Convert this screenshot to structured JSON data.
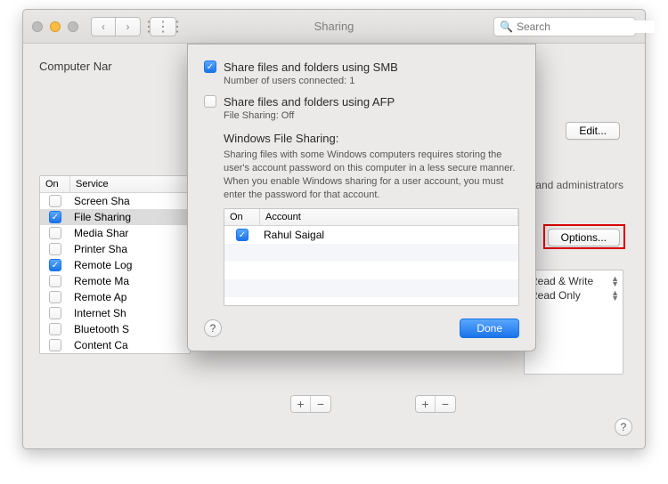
{
  "titlebar": {
    "title": "Sharing",
    "search_placeholder": "Search"
  },
  "computer_name": {
    "label": "Computer Nar"
  },
  "edit_button_label": "Edit...",
  "services": {
    "columns": {
      "on": "On",
      "service": "Service"
    },
    "items": [
      {
        "label": "Screen Sha",
        "checked": false,
        "selected": false
      },
      {
        "label": "File Sharing",
        "checked": true,
        "selected": true
      },
      {
        "label": "Media Shar",
        "checked": false,
        "selected": false
      },
      {
        "label": "Printer Sha",
        "checked": false,
        "selected": false
      },
      {
        "label": "Remote Log",
        "checked": true,
        "selected": false
      },
      {
        "label": "Remote Ma",
        "checked": false,
        "selected": false
      },
      {
        "label": "Remote Ap",
        "checked": false,
        "selected": false
      },
      {
        "label": "Internet Sh",
        "checked": false,
        "selected": false
      },
      {
        "label": "Bluetooth S",
        "checked": false,
        "selected": false
      },
      {
        "label": "Content Ca",
        "checked": false,
        "selected": false
      }
    ]
  },
  "right": {
    "admins_text": "and administrators",
    "options_label": "Options...",
    "permissions": [
      {
        "label": "Read & Write"
      },
      {
        "label": "Read Only"
      }
    ]
  },
  "modal": {
    "smb": {
      "checked": true,
      "label": "Share files and folders using SMB",
      "sub": "Number of users connected: 1"
    },
    "afp": {
      "checked": false,
      "label": "Share files and folders using AFP",
      "sub": "File Sharing: Off"
    },
    "wfs_title": "Windows File Sharing:",
    "wfs_desc": "Sharing files with some Windows computers requires storing the user's account password on this computer in a less secure manner. When you enable Windows sharing for a user account, you must enter the password for that account.",
    "accounts": {
      "columns": {
        "on": "On",
        "account": "Account"
      },
      "items": [
        {
          "label": "Rahul Saigal",
          "checked": true
        }
      ]
    },
    "done_label": "Done"
  },
  "glyphs": {
    "check": "✓",
    "help": "?",
    "plus": "+",
    "minus": "−",
    "search": "🔍",
    "back": "‹",
    "fwd": "›",
    "grid": "⋮⋮⋮"
  }
}
